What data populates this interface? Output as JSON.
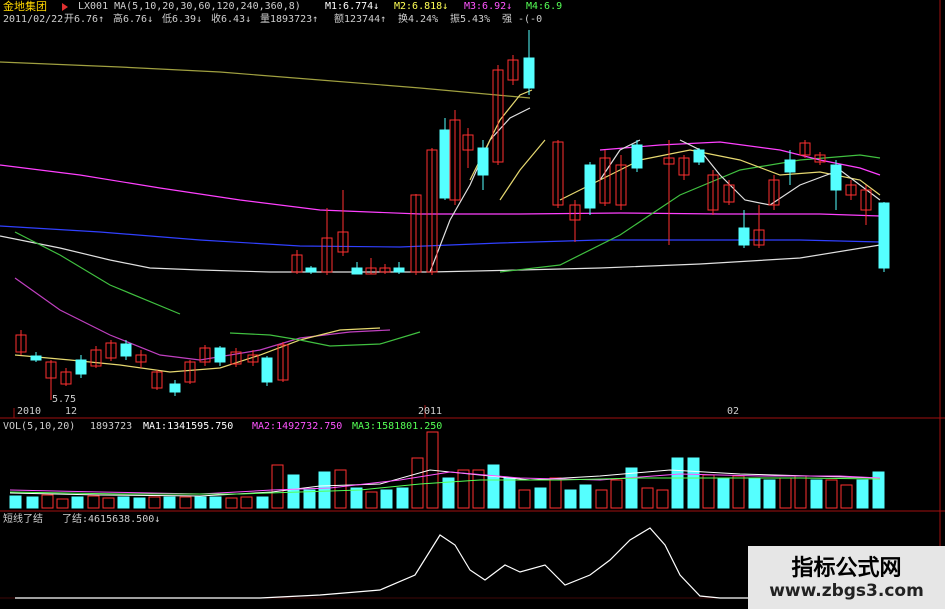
{
  "header": {
    "stock_name": "金地集团",
    "indicator_label": "LX001 MA(5,10,20,30,60,120,240,360,8)",
    "m1": "M1:6.774↓",
    "m2": "M2:6.818↓",
    "m3": "M3:6.92↓",
    "m4": "M4:6.9",
    "date": "2011/02/22",
    "open": "开6.76↑",
    "high": "高6.76↓",
    "low": "低6.39↓",
    "close": "收6.43↓",
    "volume": "量1893723↑",
    "amount": "额123744↑",
    "turnover": "换4.24%",
    "amplitude": "振5.43%",
    "strength": "强 -(-0"
  },
  "price_panel": {
    "low_marker": "5.75",
    "x_axis_labels": [
      "2010",
      "12",
      "2011",
      "02"
    ]
  },
  "volume_panel": {
    "title": "VOL(5,10,20)",
    "vol_value": "1893723",
    "ma1": "MA1:1341595.750",
    "ma2": "MA2:1492732.750",
    "ma3": "MA3:1581801.250",
    "colors": {
      "ma1": "#ffffff",
      "ma2": "#ff55ff",
      "ma3": "#00ff00"
    }
  },
  "indicator_panel": {
    "title": "短线了结",
    "value": "了结:4615638.500↓"
  },
  "watermark": {
    "title": "指标公式网",
    "url": "www.zbgs3.com"
  },
  "colors": {
    "up": "#ff3030",
    "down": "#55ffff",
    "background": "#000000",
    "border": "#a01010",
    "ma_white": "#e0e0e0",
    "ma_yellow": "#e6d870",
    "ma_magenta": "#ff40ff",
    "ma_green": "#40c040",
    "ma_blue": "#3040ff",
    "ma_olive": "#a0a040",
    "ma_purple": "#c040c0"
  }
}
